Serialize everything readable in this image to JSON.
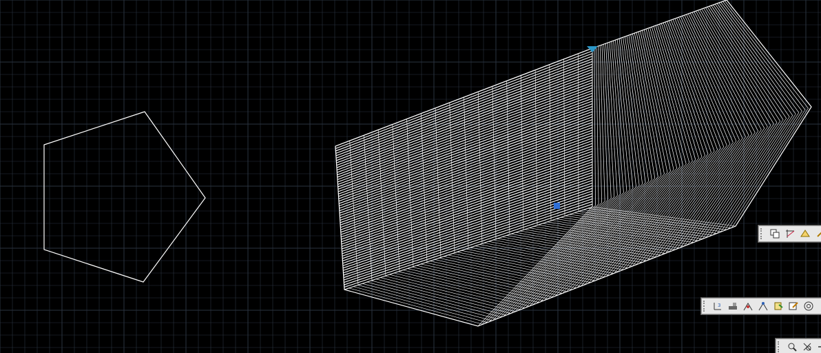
{
  "app": {
    "background": "#000000",
    "grid_color": "#2a3340",
    "line_color": "#ffffff",
    "grip_color": "#2f6fd6"
  },
  "viewport": {
    "name": "model-space-viewport"
  },
  "entities": [
    {
      "name": "pentagon-polyline",
      "type": "2d-polyline",
      "sides": 5
    },
    {
      "name": "extruded-hexagonal-prism",
      "type": "3d-solid-wireframe"
    }
  ],
  "toolbars": [
    {
      "name": "floating-toolbar-modify",
      "icons": [
        "copy-objects-icon",
        "trim-icon",
        "erase-icon",
        "more-icon"
      ]
    },
    {
      "name": "floating-toolbar-dimension",
      "icons": [
        "ucs-icon",
        "align-icon",
        "snap-icon",
        "node-snap-icon",
        "insert-block-icon",
        "edit-text-icon",
        "circle-center-icon",
        "more-icon"
      ]
    },
    {
      "name": "floating-toolbar-zoom",
      "icons": [
        "zoom-realtime-icon",
        "zoom-window-icon",
        "pan-icon"
      ]
    }
  ]
}
